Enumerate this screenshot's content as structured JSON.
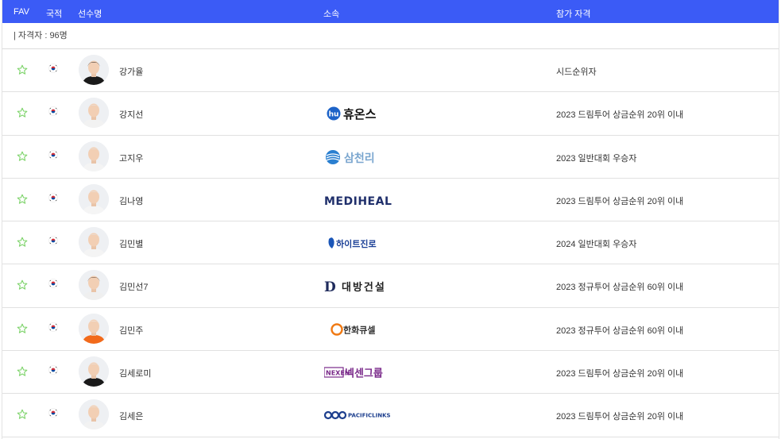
{
  "header": {
    "fav": "FAV",
    "nationality": "국적",
    "player_name": "선수명",
    "affiliation": "소속",
    "qualification": "참가 자격"
  },
  "count_text": "| 자격자 : 96명",
  "colors": {
    "header_bg": "#3b5bf6",
    "star": "#7dd36a"
  },
  "rows": [
    {
      "name": "강가율",
      "affiliation": "",
      "qualification": "시드순위자",
      "shirt": "#1a1a1a",
      "hair": "#1b1b1b"
    },
    {
      "name": "강지선",
      "affiliation": "휴온스",
      "qualification": "2023 드림투어 상금순위 20위 이내",
      "shirt": "#f2f2f2",
      "hair": "#e8e8e8"
    },
    {
      "name": "고지우",
      "affiliation": "삼천리",
      "qualification": "2023 일반대회 우승자",
      "shirt": "#f4f4f4",
      "hair": "#e4e8ee"
    },
    {
      "name": "김나영",
      "affiliation": "MEDIHEAL",
      "qualification": "2023 드림투어 상금순위 20위 이내",
      "shirt": "#f5f5f5",
      "hair": "#ebebeb"
    },
    {
      "name": "김민별",
      "affiliation": "하이트진로",
      "qualification": "2024 일반대회 우승자",
      "shirt": "#f4f4f4",
      "hair": "#e6e6e6"
    },
    {
      "name": "김민선7",
      "affiliation": "대방건설",
      "qualification": "2023 정규투어 상금순위 60위 이내",
      "shirt": "#efefef",
      "hair": "#4a3a30"
    },
    {
      "name": "김민주",
      "affiliation": "한화큐셀",
      "qualification": "2023 정규투어 상금순위 60위 이내",
      "shirt": "#f26a1b",
      "hair": "#f0f0f0"
    },
    {
      "name": "김세로미",
      "affiliation": "넥센그룹",
      "qualification": "2023 드림투어 상금순위 20위 이내",
      "shirt": "#1a1a1a",
      "hair": "#e8e8e8"
    },
    {
      "name": "김세은",
      "affiliation": "PACIFICLINKS",
      "qualification": "2023 드림투어 상금순위 20위 이내",
      "shirt": "#f2f2f2",
      "hair": "#e9e9e9"
    }
  ]
}
